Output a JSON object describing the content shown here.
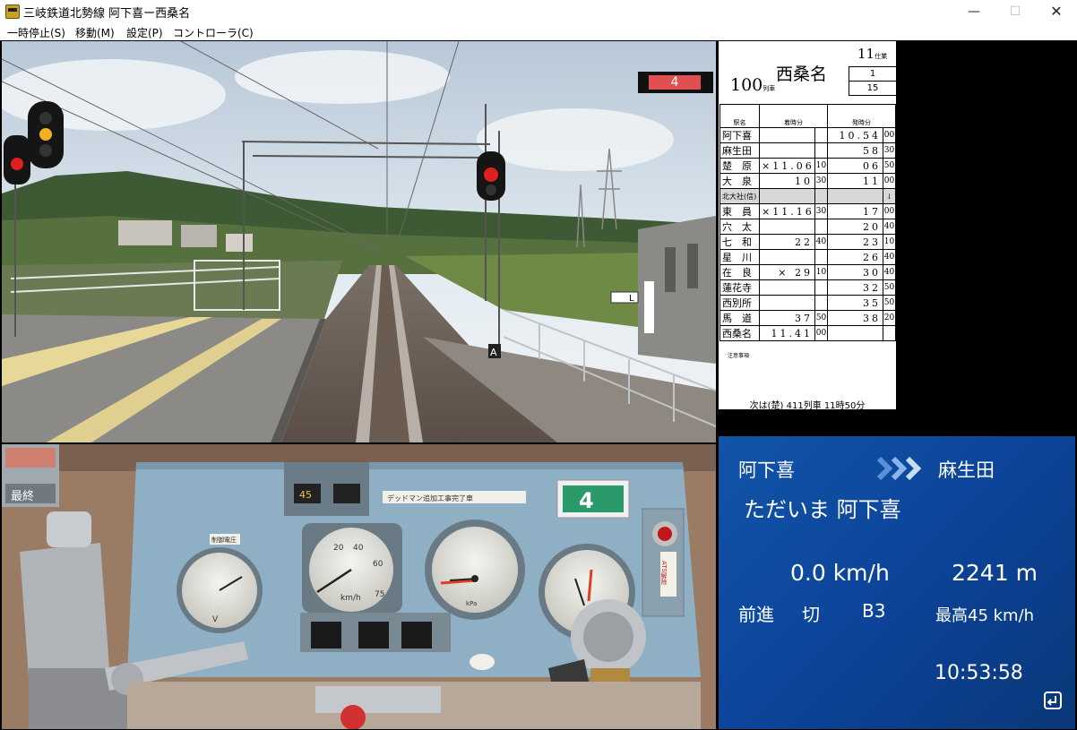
{
  "window": {
    "title": "三岐鉄道北勢線 阿下喜ー西桑名",
    "minimize": "—",
    "maximize": "☐",
    "close": "✕"
  },
  "menu": {
    "items": [
      "一時停止(S)",
      "移動(M)",
      "設定(P)",
      "コントローラ(C)"
    ]
  },
  "forward_view": {
    "car_number": "4",
    "signs": [
      "L",
      "A"
    ]
  },
  "timetable": {
    "shigyo_number": "11",
    "shigyo_label": "仕業",
    "destination": "西桑名",
    "train_number": "100",
    "train_label": "列車",
    "box1": "1",
    "box2": "15",
    "headers": {
      "station": "駅名",
      "arrival": "着時分",
      "departure": "発時分"
    },
    "rows": [
      {
        "station": "阿下喜",
        "arr": "",
        "arr_s": "",
        "dep": "10.54",
        "dep_s": "00"
      },
      {
        "station": "麻生田",
        "arr": "",
        "arr_s": "",
        "dep": "58",
        "dep_s": "30"
      },
      {
        "station": "楚　原",
        "arr": "×11.06",
        "arr_s": "10",
        "dep": "06",
        "dep_s": "50"
      },
      {
        "station": "大　泉",
        "arr": "10",
        "arr_s": "30",
        "dep": "11",
        "dep_s": "00"
      },
      {
        "station": "北大社(信)",
        "arr": "",
        "arr_s": "",
        "dep": "",
        "dep_s": "↓",
        "passing": true
      },
      {
        "station": "東　員",
        "arr": "×11.16",
        "arr_s": "30",
        "dep": "17",
        "dep_s": "00"
      },
      {
        "station": "穴　太",
        "arr": "",
        "arr_s": "",
        "dep": "20",
        "dep_s": "40"
      },
      {
        "station": "七　和",
        "arr": "22",
        "arr_s": "40",
        "dep": "23",
        "dep_s": "10"
      },
      {
        "station": "星　川",
        "arr": "",
        "arr_s": "",
        "dep": "26",
        "dep_s": "40"
      },
      {
        "station": "在　良",
        "arr": "× 29",
        "arr_s": "10",
        "dep": "30",
        "dep_s": "40"
      },
      {
        "station": "蓮花寺",
        "arr": "",
        "arr_s": "",
        "dep": "32",
        "dep_s": "50"
      },
      {
        "station": "西別所",
        "arr": "",
        "arr_s": "",
        "dep": "35",
        "dep_s": "50"
      },
      {
        "station": "馬　道",
        "arr": "37",
        "arr_s": "50",
        "dep": "38",
        "dep_s": "20"
      },
      {
        "station": "西桑名",
        "arr": "11.41",
        "arr_s": "00",
        "dep": "",
        "dep_s": ""
      }
    ],
    "notes_label": "注意事項",
    "next_info": "次は(楚) 411列車 11時50分"
  },
  "cab": {
    "labels": {
      "last_lamp": "最終",
      "panel_counter": "45",
      "notice_plate": "デッドマン追加工事完了車",
      "unit_number": "4",
      "speed_unit": "km/h",
      "pressure_unit": "kPa",
      "volt_unit": "V",
      "ammeter_label": "制御電圧",
      "ats_label": "ATS解除"
    },
    "speedometer_ticks": [
      "20",
      "40",
      "60",
      "75"
    ]
  },
  "info": {
    "current_station": "阿下喜",
    "next_station": "麻生田",
    "status_message": "ただいま 阿下喜",
    "speed": "0.0 km/h",
    "distance": "2241 m",
    "reverser": "前進",
    "power": "切",
    "brake": "B3",
    "speed_limit": "最高45 km/h",
    "clock": "10:53:58"
  },
  "colors": {
    "panel_blue": "#0c449a",
    "signal_yellow": "#f0b020",
    "signal_red": "#e02020",
    "car_number_red": "#e05050"
  }
}
